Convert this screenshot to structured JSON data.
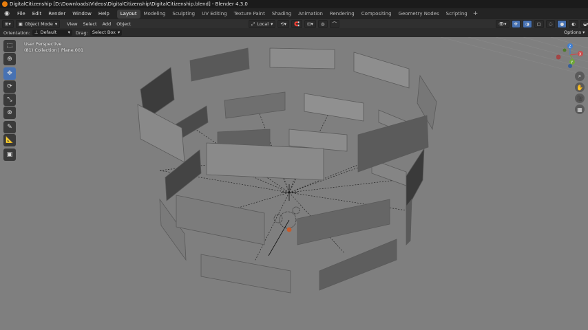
{
  "window": {
    "title": "DigitalCitizenship [D:\\Downloads\\Videos\\DigitalCitizenship\\DigitalCitizenship.blend] - Blender 4.3.0"
  },
  "menu": [
    "File",
    "Edit",
    "Render",
    "Window",
    "Help"
  ],
  "workspaces": [
    {
      "label": "Layout",
      "active": true
    },
    {
      "label": "Modeling"
    },
    {
      "label": "Sculpting"
    },
    {
      "label": "UV Editing"
    },
    {
      "label": "Texture Paint"
    },
    {
      "label": "Shading"
    },
    {
      "label": "Animation"
    },
    {
      "label": "Rendering"
    },
    {
      "label": "Compositing"
    },
    {
      "label": "Geometry Nodes"
    },
    {
      "label": "Scripting"
    }
  ],
  "header": {
    "mode": "Object Mode",
    "menus": [
      "View",
      "Select",
      "Add",
      "Object"
    ],
    "transform_orientation": "Local"
  },
  "tool_settings": {
    "orientation_label": "Orientation:",
    "orientation_value": "Default",
    "drag_label": "Drag:",
    "drag_value": "Select Box",
    "options_label": "Options"
  },
  "viewport": {
    "view_name": "User Perspective",
    "collection_info": "(81) Collection | Plane.001",
    "background_color": "#7f7f7f"
  },
  "gizmo": {
    "x_label": "X",
    "y_label": "Y",
    "z_label": "Z"
  },
  "icons": {
    "toolbar": [
      "select-box-icon",
      "cursor-icon",
      "move-icon",
      "rotate-icon",
      "scale-icon",
      "transform-icon",
      "annotate-icon",
      "measure-icon",
      "add-cube-icon"
    ],
    "navigation": [
      "zoom-icon",
      "hand-icon",
      "camera-view-icon",
      "grid-view-icon"
    ]
  },
  "colors": {
    "accent": "#4772b3",
    "x_axis": "#c94d4d",
    "y_axis": "#6fa63a",
    "z_axis": "#3f7ed1"
  }
}
